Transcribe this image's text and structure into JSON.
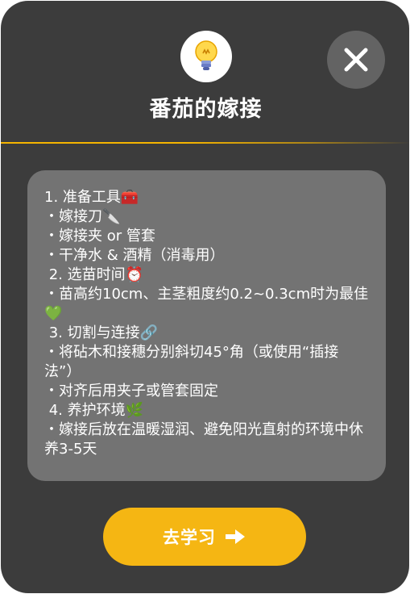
{
  "dialog": {
    "title": "番茄的嫁接",
    "content": "1. 准备工具🧰\n・嫁接刀🔪\n・嫁接夹 or 管套\n・干净水 & 酒精（消毒用）\n 2. 选苗时间⏰\n・苗高约10cm、主茎粗度约0.2~0.3cm时为最佳💚\n 3. 切割与连接🔗\n・将砧木和接穗分别斜切45°角（或使用“插接法”）\n・对齐后用夹子或管套固定\n 4. 养护环境🌿\n・嫁接后放在温暖湿润、避免阳光直射的环境中休养3-5天",
    "action_label": "去学习",
    "header_icon": "lightbulb-icon",
    "close_icon": "close-icon",
    "action_icon": "arrow-right-icon"
  },
  "colors": {
    "background": "#3c3c3c",
    "content_panel": "#737373",
    "accent": "#f5b613",
    "close_button": "#636363"
  }
}
